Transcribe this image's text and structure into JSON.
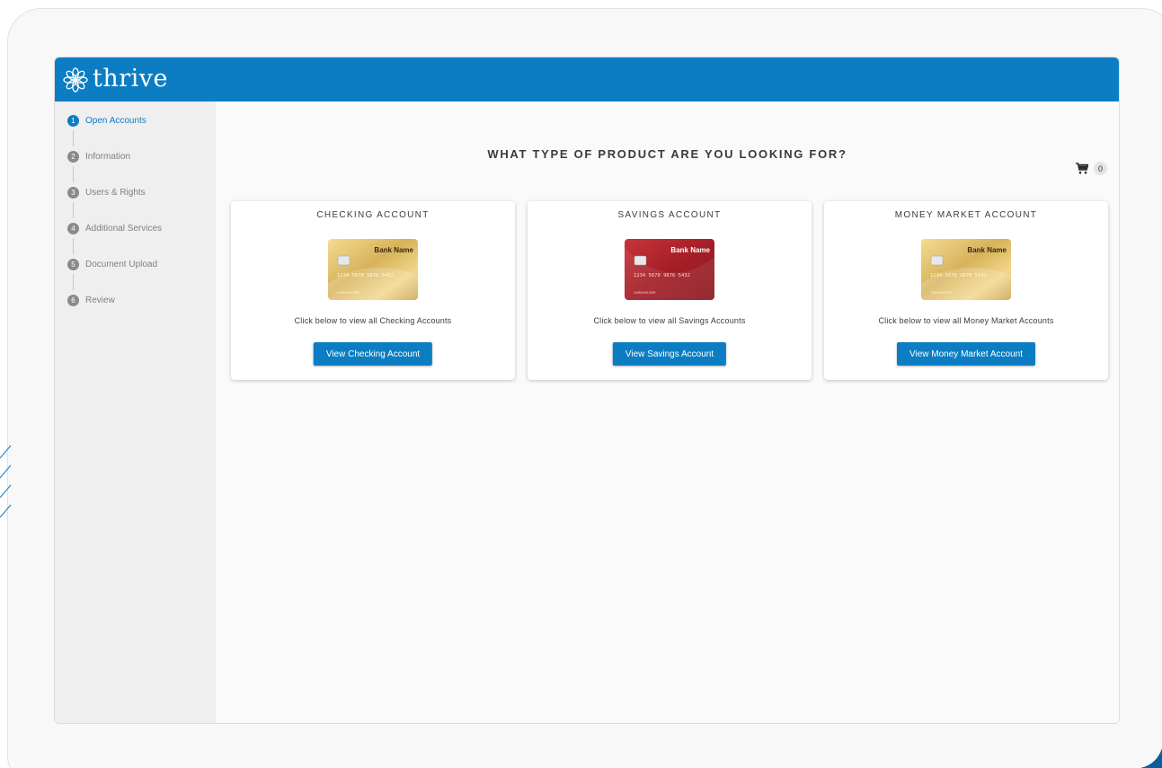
{
  "app": {
    "logo_text": "thrive"
  },
  "colors": {
    "brand": "#0c7dc2",
    "sidebar_bg": "#efefef",
    "card_gold": "#d9b45a",
    "card_red": "#b3242c"
  },
  "sidebar": {
    "steps": [
      {
        "num": "1",
        "label": "Open Accounts",
        "active": true
      },
      {
        "num": "2",
        "label": "Information",
        "active": false
      },
      {
        "num": "3",
        "label": "Users & Rights",
        "active": false
      },
      {
        "num": "4",
        "label": "Additional Services",
        "active": false
      },
      {
        "num": "5",
        "label": "Document Upload",
        "active": false
      },
      {
        "num": "6",
        "label": "Review",
        "active": false
      }
    ]
  },
  "main": {
    "title": "WHAT TYPE OF PRODUCT ARE YOU LOOKING FOR?",
    "cart": {
      "icon": "cart-icon",
      "count": "0"
    },
    "cards": [
      {
        "title": "CHECKING ACCOUNT",
        "bank_card": {
          "bank": "Bank Name",
          "number": "1234 5678 9876 5432",
          "holder": "CARDHOLDER",
          "color": "gold"
        },
        "description": "Click below to view all Checking Accounts",
        "button": "View Checking Account"
      },
      {
        "title": "SAVINGS ACCOUNT",
        "bank_card": {
          "bank": "Bank Name",
          "number": "1234 5678 9876 5432",
          "holder": "CARDHOLDER",
          "color": "red"
        },
        "description": "Click below to view all Savings Accounts",
        "button": "View Savings Account"
      },
      {
        "title": "MONEY MARKET ACCOUNT",
        "bank_card": {
          "bank": "Bank Name",
          "number": "1234 5678 9876 5432",
          "holder": "CARDHOLDER",
          "color": "gold"
        },
        "description": "Click below to view all Money Market Accounts",
        "button": "View Money Market Account"
      }
    ]
  }
}
